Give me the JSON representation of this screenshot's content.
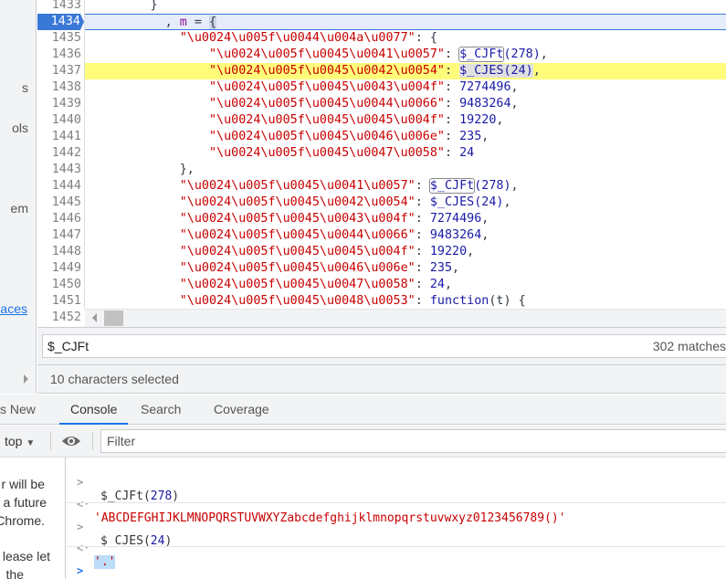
{
  "left_panel": {
    "fragments": [
      "s",
      "ols",
      "em",
      "paces"
    ]
  },
  "editor": {
    "current_line": 1434,
    "highlighted_line": 1437,
    "lines": [
      {
        "n": "1433",
        "indent": 8,
        "tokens": [
          [
            "pun",
            "}"
          ]
        ]
      },
      {
        "n": "1434",
        "indent": 10,
        "tokens": [
          [
            "pun",
            ", "
          ],
          [
            "var",
            "m"
          ],
          [
            "pun",
            " = "
          ],
          [
            "brk",
            "{"
          ]
        ]
      },
      {
        "n": "1435",
        "indent": 12,
        "tokens": [
          [
            "str",
            "\"\\u0024\\u005f\\u0044\\u004a\\u0077\""
          ],
          [
            "pun",
            ": {"
          ]
        ]
      },
      {
        "n": "1436",
        "indent": 16,
        "tokens": [
          [
            "str",
            "\"\\u0024\\u005f\\u0045\\u0041\\u0057\""
          ],
          [
            "pun",
            ": "
          ],
          [
            "fnb",
            "$_CJFt"
          ],
          [
            "fn",
            "(278)"
          ],
          [
            "pun",
            ","
          ]
        ]
      },
      {
        "n": "1437",
        "indent": 16,
        "tokens": [
          [
            "str",
            "\"\\u0024\\u005f\\u0045\\u0042\\u0054\""
          ],
          [
            "pun",
            ": "
          ],
          [
            "fns",
            "$_CJES(24)"
          ],
          [
            "pun",
            ","
          ]
        ]
      },
      {
        "n": "1438",
        "indent": 16,
        "tokens": [
          [
            "str",
            "\"\\u0024\\u005f\\u0045\\u0043\\u004f\""
          ],
          [
            "pun",
            ": "
          ],
          [
            "num",
            "7274496"
          ],
          [
            "pun",
            ","
          ]
        ]
      },
      {
        "n": "1439",
        "indent": 16,
        "tokens": [
          [
            "str",
            "\"\\u0024\\u005f\\u0045\\u0044\\u0066\""
          ],
          [
            "pun",
            ": "
          ],
          [
            "num",
            "9483264"
          ],
          [
            "pun",
            ","
          ]
        ]
      },
      {
        "n": "1440",
        "indent": 16,
        "tokens": [
          [
            "str",
            "\"\\u0024\\u005f\\u0045\\u0045\\u004f\""
          ],
          [
            "pun",
            ": "
          ],
          [
            "num",
            "19220"
          ],
          [
            "pun",
            ","
          ]
        ]
      },
      {
        "n": "1441",
        "indent": 16,
        "tokens": [
          [
            "str",
            "\"\\u0024\\u005f\\u0045\\u0046\\u006e\""
          ],
          [
            "pun",
            ": "
          ],
          [
            "num",
            "235"
          ],
          [
            "pun",
            ","
          ]
        ]
      },
      {
        "n": "1442",
        "indent": 16,
        "tokens": [
          [
            "str",
            "\"\\u0024\\u005f\\u0045\\u0047\\u0058\""
          ],
          [
            "pun",
            ": "
          ],
          [
            "num",
            "24"
          ]
        ]
      },
      {
        "n": "1443",
        "indent": 12,
        "tokens": [
          [
            "pun",
            "},"
          ]
        ]
      },
      {
        "n": "1444",
        "indent": 12,
        "tokens": [
          [
            "str",
            "\"\\u0024\\u005f\\u0045\\u0041\\u0057\""
          ],
          [
            "pun",
            ": "
          ],
          [
            "fnb",
            "$_CJFt"
          ],
          [
            "fn",
            "(278)"
          ],
          [
            "pun",
            ","
          ]
        ]
      },
      {
        "n": "1445",
        "indent": 12,
        "tokens": [
          [
            "str",
            "\"\\u0024\\u005f\\u0045\\u0042\\u0054\""
          ],
          [
            "pun",
            ": "
          ],
          [
            "fn",
            "$_CJES(24)"
          ],
          [
            "pun",
            ","
          ]
        ]
      },
      {
        "n": "1446",
        "indent": 12,
        "tokens": [
          [
            "str",
            "\"\\u0024\\u005f\\u0045\\u0043\\u004f\""
          ],
          [
            "pun",
            ": "
          ],
          [
            "num",
            "7274496"
          ],
          [
            "pun",
            ","
          ]
        ]
      },
      {
        "n": "1447",
        "indent": 12,
        "tokens": [
          [
            "str",
            "\"\\u0024\\u005f\\u0045\\u0044\\u0066\""
          ],
          [
            "pun",
            ": "
          ],
          [
            "num",
            "9483264"
          ],
          [
            "pun",
            ","
          ]
        ]
      },
      {
        "n": "1448",
        "indent": 12,
        "tokens": [
          [
            "str",
            "\"\\u0024\\u005f\\u0045\\u0045\\u004f\""
          ],
          [
            "pun",
            ": "
          ],
          [
            "num",
            "19220"
          ],
          [
            "pun",
            ","
          ]
        ]
      },
      {
        "n": "1449",
        "indent": 12,
        "tokens": [
          [
            "str",
            "\"\\u0024\\u005f\\u0045\\u0046\\u006e\""
          ],
          [
            "pun",
            ": "
          ],
          [
            "num",
            "235"
          ],
          [
            "pun",
            ","
          ]
        ]
      },
      {
        "n": "1450",
        "indent": 12,
        "tokens": [
          [
            "str",
            "\"\\u0024\\u005f\\u0045\\u0047\\u0058\""
          ],
          [
            "pun",
            ": "
          ],
          [
            "num",
            "24"
          ],
          [
            "pun",
            ","
          ]
        ]
      },
      {
        "n": "1451",
        "indent": 12,
        "tokens": [
          [
            "str",
            "\"\\u0024\\u005f\\u0045\\u0048\\u0053\""
          ],
          [
            "pun",
            ": "
          ],
          [
            "fn",
            "function"
          ],
          [
            "pun",
            "(t) {"
          ]
        ]
      },
      {
        "n": "1452",
        "indent": 0,
        "tokens": []
      }
    ]
  },
  "search": {
    "query": "$_CJFt",
    "matches": "302 matches"
  },
  "status": "10 characters selected",
  "tabs": [
    {
      "label": "s New",
      "active": false
    },
    {
      "label": "Console",
      "active": true
    },
    {
      "label": "Search",
      "active": false
    },
    {
      "label": "Coverage",
      "active": false
    }
  ],
  "console_toolbar": {
    "context": "top",
    "filter_placeholder": "Filter",
    "eye_icon": "eye-icon"
  },
  "console_left": {
    "fragments": [
      "r will be",
      "a future",
      "Chrome.",
      "lease let",
      "the"
    ]
  },
  "console": {
    "entries": [
      {
        "input_name": "$_CJFt",
        "input_arg": "278",
        "open": "(",
        "close": ")",
        "result": "'ABCDEFGHIJKLMNOPQRSTUVWXYZabcdefghijklmnopqrstuvwxyz0123456789()'"
      },
      {
        "input_name": "$_CJES",
        "input_arg": "24",
        "open": "(",
        "close": ")",
        "result": "'.'"
      }
    ],
    "prompt_symbol": ">"
  },
  "colors": {
    "accent": "#1a73e8",
    "current_line": "#3a78d8",
    "highlight": "#fffc7c",
    "string": "#c80000",
    "number": "#1a1aa6"
  }
}
